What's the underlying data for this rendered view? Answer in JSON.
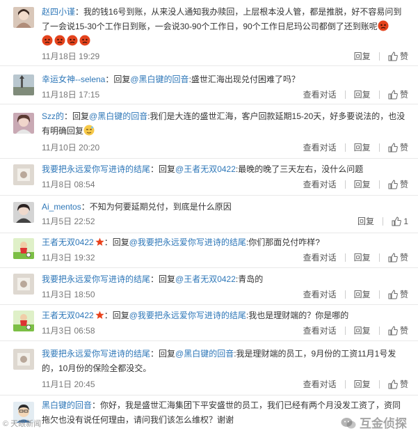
{
  "comments": [
    {
      "user": "赵四小谨",
      "text_a": "：我的钱16号到账，从来没人通知我办赎回，上层根本没人管，都是推脱，好不容易问到了一会说15-30个工作日到账，一会说30-90个工作日，90个工作日尼玛公司都倒了还到账呢",
      "time": "11月18日 19:29",
      "reply": "回复",
      "like": "赞"
    },
    {
      "user": "幸运女神--selena",
      "text_a": "：回复",
      "mention": "@黑白键的回音",
      "text_b": ":盛世汇海出现兑付困难了吗？",
      "time": "11月18日 17:15",
      "view": "查看对话",
      "reply": "回复",
      "like": "赞"
    },
    {
      "user": "Szz的",
      "text_a": "：回复",
      "mention": "@黑白键的回音",
      "text_b": ":我们是大连的盛世汇海，客户回款延期15-20天，好多要说法的，也没有明确回复",
      "time": "11月10日 20:20",
      "view": "查看对话",
      "reply": "回复",
      "like": "赞"
    },
    {
      "user": "我要把永远爱你写进诗的结尾",
      "text_a": "：回复",
      "mention": "@王者无双0422",
      "text_b": ":最晚的晚了三天左右，没什么问题",
      "time": "11月8日 08:54",
      "view": "查看对话",
      "reply": "回复",
      "like": "赞"
    },
    {
      "user": "Ai_mentos",
      "text_a": "：不知为何要延期兑付，到底是什么原因",
      "time": "11月5日 22:52",
      "reply": "回复",
      "like_count": "1"
    },
    {
      "user": "王者无双0422",
      "text_a": "：回复",
      "mention": "@我要把永远爱你写进诗的结尾",
      "text_b": ":你们那面兑付咋样?",
      "time": "11月3日 19:32",
      "view": "查看对话",
      "reply": "回复",
      "like": "赞"
    },
    {
      "user": "我要把永远爱你写进诗的结尾",
      "text_a": "：回复",
      "mention": "@王者无双0422",
      "text_b": ":青岛的",
      "time": "11月3日 18:50",
      "view": "查看对话",
      "reply": "回复",
      "like": "赞"
    },
    {
      "user": "王者无双0422",
      "text_a": "：回复",
      "mention": "@我要把永远爱你写进诗的结尾",
      "text_b": ":我也是理财端的？你是哪的",
      "time": "11月3日 06:58",
      "view": "查看对话",
      "reply": "回复",
      "like": "赞"
    },
    {
      "user": "我要把永远爱你写进诗的结尾",
      "text_a": "：回复",
      "mention": "@黑白键的回音",
      "text_b": ":我是理财端的员工，9月份的工资11月1号发的，10月份的保险全都没交。",
      "time": "11月1日 20:45",
      "view": "查看对话",
      "reply": "回复",
      "like": "赞"
    },
    {
      "user": "黑白键的回音",
      "text_a": "：你好，我是盛世汇海集团下平安盛世的员工，我们已经有两个月没发工资了，资同拖欠也没有说任何理由，请问我们该怎么维权？谢谢"
    }
  ],
  "watermark": {
    "left": "© 天眼新闻",
    "right": "互金侦探"
  },
  "colors": {
    "link": "#2e77b8",
    "text": "#333333",
    "meta": "#777777",
    "badge": "#e8411b"
  }
}
